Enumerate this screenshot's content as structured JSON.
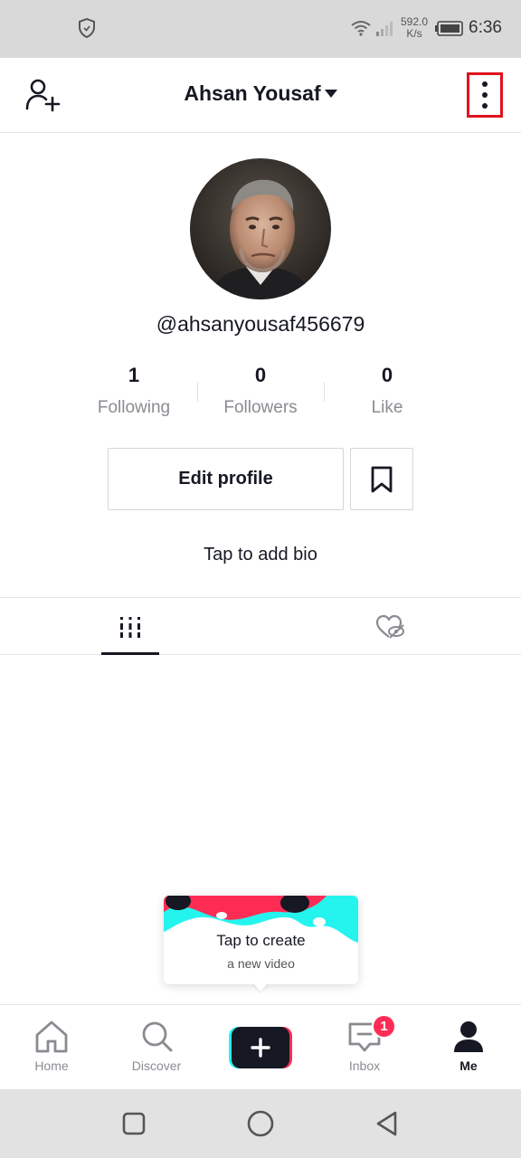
{
  "status_bar": {
    "time": "6:36",
    "net_speed_value": "592.0",
    "net_speed_unit": "K/s",
    "icons": [
      "shield-icon",
      "wifi-icon",
      "signal-icon",
      "battery-icon"
    ]
  },
  "header": {
    "title": "Ahsan Yousaf",
    "icons": [
      "add-user-icon",
      "dropdown-caret-icon",
      "more-options-icon"
    ]
  },
  "profile": {
    "username": "@ahsanyousaf456679",
    "stats": [
      {
        "value": "1",
        "label": "Following"
      },
      {
        "value": "0",
        "label": "Followers"
      },
      {
        "value": "0",
        "label": "Like"
      }
    ],
    "edit_label": "Edit profile",
    "bio_prompt": "Tap to add bio"
  },
  "tabs": {
    "icons": [
      "videos-grid-icon",
      "liked-hidden-icon"
    ],
    "active": 0
  },
  "tooltip": {
    "title": "Tap to create",
    "subtitle": "a new video"
  },
  "bottom_nav": {
    "items": [
      {
        "label": "Home",
        "icon": "home-icon"
      },
      {
        "label": "Discover",
        "icon": "search-icon"
      },
      {
        "label": "",
        "icon": "create-plus-icon"
      },
      {
        "label": "Inbox",
        "icon": "inbox-icon"
      },
      {
        "label": "Me",
        "icon": "profile-icon"
      }
    ],
    "inbox_badge": "1",
    "active": "Me"
  },
  "colors": {
    "accent_red": "#fe2c55",
    "accent_cyan": "#25f4ee",
    "highlight_box": "#e0141e",
    "text_primary": "#161823",
    "text_secondary": "#8a8b91"
  }
}
